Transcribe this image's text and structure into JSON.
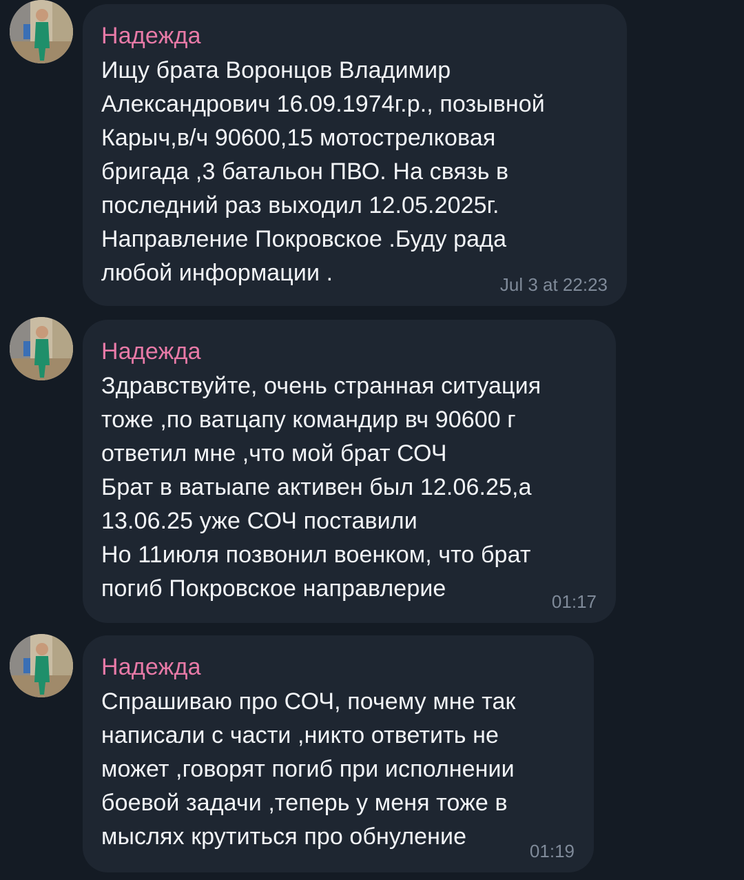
{
  "messages": [
    {
      "sender": "Надежда",
      "text": "Ищу брата Воронцов Владимир\nАлександрович 16.09.1974г.р., позывной\nКарыч,в/ч 90600,15 мотострелковая\nбригада ,3 батальон ПВО. На связь в\nпоследний раз выходил 12.05.2025г.\nНаправление Покровское .Буду рада\nлюбой информации .",
      "time": "Jul 3 at 22:23"
    },
    {
      "sender": "Надежда",
      "text": "Здравствуйте, очень странная ситуация\nтоже ,по ватцапу командир вч 90600 г\nответил мне ,что мой брат СОЧ\nБрат в ватыапе активен был 12.06.25,а\n13.06.25 уже СОЧ поставили\nНо 11июля позвонил военком, что брат\nпогиб Покровское направлерие",
      "time": "01:17"
    },
    {
      "sender": "Надежда",
      "text": "Спрашиваю про СОЧ, почему мне так\nнаписали с части ,никто ответить не\nможет ,говорят погиб при исполнении\nбоевой задачи ,теперь у меня тоже в\nмыслях крутиться про обнуление",
      "time": "01:19"
    }
  ],
  "colors": {
    "background": "#141b24",
    "bubble": "#1e2631",
    "sender_name": "#e87aa7",
    "text": "#f2f4f7",
    "timestamp": "#7f8a99"
  },
  "icons": {
    "avatar": "user-avatar-photo"
  }
}
